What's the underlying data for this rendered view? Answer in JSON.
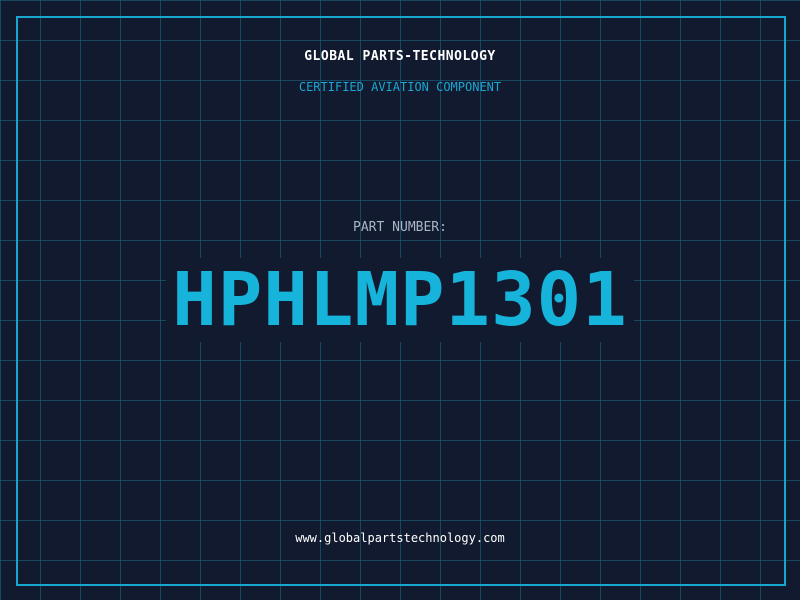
{
  "colors": {
    "background": "#111a2e",
    "grid": "#1b6e8c",
    "frame": "#17a6cf",
    "brand_text": "#ffffff",
    "subtitle_text": "#1ba6d4",
    "label_text": "#a9b6c6",
    "part_number_text": "#16b3da",
    "url_text": "#ffffff"
  },
  "header": {
    "brand": "GLOBAL PARTS-TECHNOLOGY",
    "subtitle": "CERTIFIED AVIATION COMPONENT"
  },
  "main": {
    "label": "PART NUMBER:",
    "part_number": "HPHLMP1301"
  },
  "footer": {
    "url": "www.globalpartstechnology.com"
  }
}
